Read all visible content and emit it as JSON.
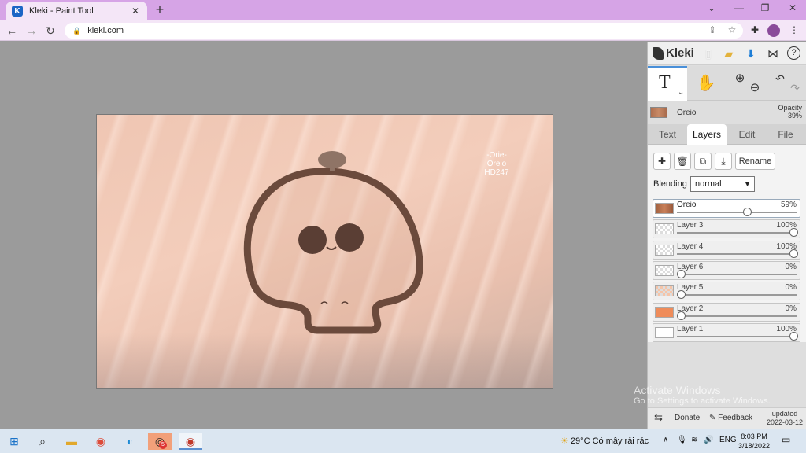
{
  "browser": {
    "tab_title": "Kleki - Paint Tool",
    "tab_close": "✕",
    "new_tab": "+",
    "url": "kleki.com",
    "win_min": "⌄",
    "win_minimize": "—",
    "win_restore": "❐",
    "win_close": "✕"
  },
  "canvas": {
    "credit_line1": "-Orie-",
    "credit_line2": "Oreio",
    "credit_line3": "HD247"
  },
  "panel": {
    "app_name": "Kleki",
    "active_tool": "T",
    "tool_chevron": "⌄",
    "brush_name": "Oreio",
    "opacity_label": "Opacity",
    "opacity_value": "39%",
    "tabs": [
      "Text",
      "Layers",
      "Edit",
      "File"
    ],
    "active_tab": "Layers",
    "rename_label": "Rename",
    "blending_label": "Blending",
    "blending_value": "normal",
    "layers": [
      {
        "name": "Oreio",
        "opacity": "59%",
        "value": 0.59,
        "active": true,
        "thumb": "brown"
      },
      {
        "name": "Layer 3",
        "opacity": "100%",
        "value": 1.0,
        "active": false,
        "thumb": "sketch"
      },
      {
        "name": "Layer 4",
        "opacity": "100%",
        "value": 1.0,
        "active": false,
        "thumb": "dots"
      },
      {
        "name": "Layer 6",
        "opacity": "0%",
        "value": 0.0,
        "active": false,
        "thumb": "blank"
      },
      {
        "name": "Layer 5",
        "opacity": "0%",
        "value": 0.0,
        "active": false,
        "thumb": "peach"
      },
      {
        "name": "Layer 2",
        "opacity": "0%",
        "value": 0.0,
        "active": false,
        "thumb": "orange"
      },
      {
        "name": "Layer 1",
        "opacity": "100%",
        "value": 1.0,
        "active": false,
        "thumb": "white"
      }
    ],
    "donate_label": "Donate",
    "feedback_label": "Feedback",
    "updated_line1": "updated",
    "updated_line2": "2022-03-12"
  },
  "watermark": {
    "title": "Activate Windows",
    "subtitle": "Go to Settings to activate Windows."
  },
  "taskbar": {
    "weather": "29°C  Có mây rải rác",
    "lang": "ENG",
    "time": "8:03 PM",
    "date": "3/18/2022",
    "badge_count": "5"
  }
}
